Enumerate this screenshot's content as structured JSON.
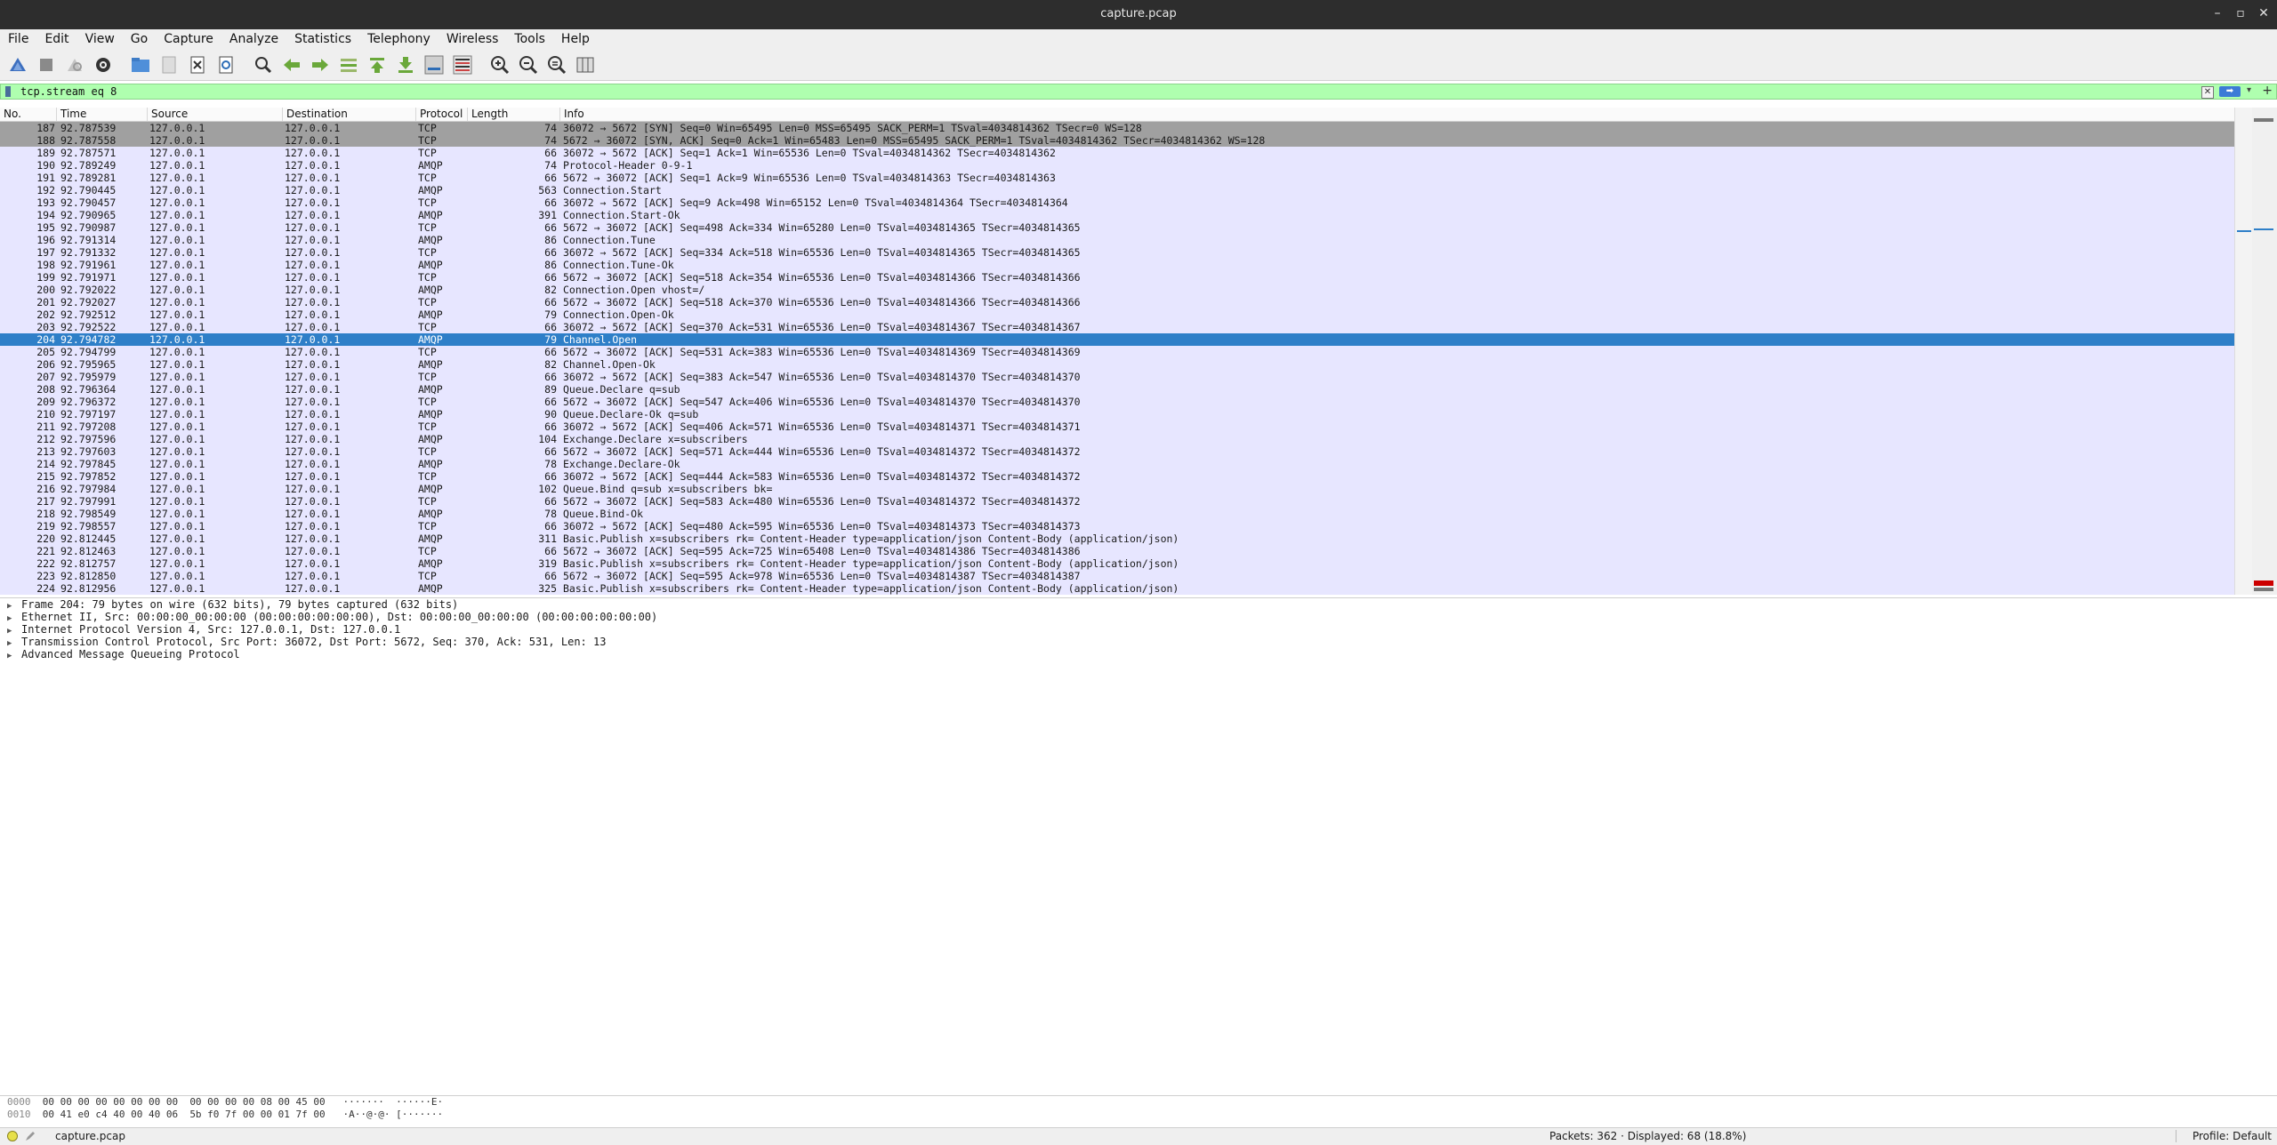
{
  "window": {
    "title": "capture.pcap"
  },
  "menu": [
    "File",
    "Edit",
    "View",
    "Go",
    "Capture",
    "Analyze",
    "Statistics",
    "Telephony",
    "Wireless",
    "Tools",
    "Help"
  ],
  "toolbar_icons": [
    "shark-start-icon",
    "stop-icon",
    "restart-icon",
    "options-gear-icon",
    "open-folder-icon",
    "file-icon",
    "close-file-icon",
    "reload-icon",
    "find-icon",
    "go-back-icon",
    "go-forward-icon",
    "go-to-packet-icon",
    "first-packet-icon",
    "last-packet-icon",
    "autoscroll-icon",
    "colorize-icon",
    "zoom-in-icon",
    "zoom-out-icon",
    "zoom-normal-icon",
    "resize-columns-icon"
  ],
  "filter": {
    "value": "tcp.stream eq 8"
  },
  "columns": [
    "No.",
    "Time",
    "Source",
    "Destination",
    "Protocol",
    "Length",
    "Info"
  ],
  "packets": [
    {
      "no": "187",
      "time": "92.787539",
      "src": "127.0.0.1",
      "dst": "127.0.0.1",
      "proto": "TCP",
      "len": "74",
      "info": "36072 → 5672 [SYN] Seq=0 Win=65495 Len=0 MSS=65495 SACK_PERM=1 TSval=4034814362 TSecr=0 WS=128",
      "style": "s"
    },
    {
      "no": "188",
      "time": "92.787558",
      "src": "127.0.0.1",
      "dst": "127.0.0.1",
      "proto": "TCP",
      "len": "74",
      "info": "5672 → 36072 [SYN, ACK] Seq=0 Ack=1 Win=65483 Len=0 MSS=65495 SACK_PERM=1 TSval=4034814362 TSecr=4034814362 WS=128",
      "style": "s"
    },
    {
      "no": "189",
      "time": "92.787571",
      "src": "127.0.0.1",
      "dst": "127.0.0.1",
      "proto": "TCP",
      "len": "66",
      "info": "36072 → 5672 [ACK] Seq=1 Ack=1 Win=65536 Len=0 TSval=4034814362 TSecr=4034814362",
      "style": ""
    },
    {
      "no": "190",
      "time": "92.789249",
      "src": "127.0.0.1",
      "dst": "127.0.0.1",
      "proto": "AMQP",
      "len": "74",
      "info": "Protocol-Header 0-9-1",
      "style": ""
    },
    {
      "no": "191",
      "time": "92.789281",
      "src": "127.0.0.1",
      "dst": "127.0.0.1",
      "proto": "TCP",
      "len": "66",
      "info": "5672 → 36072 [ACK] Seq=1 Ack=9 Win=65536 Len=0 TSval=4034814363 TSecr=4034814363",
      "style": ""
    },
    {
      "no": "192",
      "time": "92.790445",
      "src": "127.0.0.1",
      "dst": "127.0.0.1",
      "proto": "AMQP",
      "len": "563",
      "info": "Connection.Start",
      "style": ""
    },
    {
      "no": "193",
      "time": "92.790457",
      "src": "127.0.0.1",
      "dst": "127.0.0.1",
      "proto": "TCP",
      "len": "66",
      "info": "36072 → 5672 [ACK] Seq=9 Ack=498 Win=65152 Len=0 TSval=4034814364 TSecr=4034814364",
      "style": ""
    },
    {
      "no": "194",
      "time": "92.790965",
      "src": "127.0.0.1",
      "dst": "127.0.0.1",
      "proto": "AMQP",
      "len": "391",
      "info": "Connection.Start-Ok",
      "style": ""
    },
    {
      "no": "195",
      "time": "92.790987",
      "src": "127.0.0.1",
      "dst": "127.0.0.1",
      "proto": "TCP",
      "len": "66",
      "info": "5672 → 36072 [ACK] Seq=498 Ack=334 Win=65280 Len=0 TSval=4034814365 TSecr=4034814365",
      "style": ""
    },
    {
      "no": "196",
      "time": "92.791314",
      "src": "127.0.0.1",
      "dst": "127.0.0.1",
      "proto": "AMQP",
      "len": "86",
      "info": "Connection.Tune",
      "style": ""
    },
    {
      "no": "197",
      "time": "92.791332",
      "src": "127.0.0.1",
      "dst": "127.0.0.1",
      "proto": "TCP",
      "len": "66",
      "info": "36072 → 5672 [ACK] Seq=334 Ack=518 Win=65536 Len=0 TSval=4034814365 TSecr=4034814365",
      "style": ""
    },
    {
      "no": "198",
      "time": "92.791961",
      "src": "127.0.0.1",
      "dst": "127.0.0.1",
      "proto": "AMQP",
      "len": "86",
      "info": "Connection.Tune-Ok",
      "style": ""
    },
    {
      "no": "199",
      "time": "92.791971",
      "src": "127.0.0.1",
      "dst": "127.0.0.1",
      "proto": "TCP",
      "len": "66",
      "info": "5672 → 36072 [ACK] Seq=518 Ack=354 Win=65536 Len=0 TSval=4034814366 TSecr=4034814366",
      "style": ""
    },
    {
      "no": "200",
      "time": "92.792022",
      "src": "127.0.0.1",
      "dst": "127.0.0.1",
      "proto": "AMQP",
      "len": "82",
      "info": "Connection.Open vhost=/",
      "style": ""
    },
    {
      "no": "201",
      "time": "92.792027",
      "src": "127.0.0.1",
      "dst": "127.0.0.1",
      "proto": "TCP",
      "len": "66",
      "info": "5672 → 36072 [ACK] Seq=518 Ack=370 Win=65536 Len=0 TSval=4034814366 TSecr=4034814366",
      "style": ""
    },
    {
      "no": "202",
      "time": "92.792512",
      "src": "127.0.0.1",
      "dst": "127.0.0.1",
      "proto": "AMQP",
      "len": "79",
      "info": "Connection.Open-Ok",
      "style": ""
    },
    {
      "no": "203",
      "time": "92.792522",
      "src": "127.0.0.1",
      "dst": "127.0.0.1",
      "proto": "TCP",
      "len": "66",
      "info": "36072 → 5672 [ACK] Seq=370 Ack=531 Win=65536 Len=0 TSval=4034814367 TSecr=4034814367",
      "style": ""
    },
    {
      "no": "204",
      "time": "92.794782",
      "src": "127.0.0.1",
      "dst": "127.0.0.1",
      "proto": "AMQP",
      "len": "79",
      "info": "Channel.Open",
      "style": "sel"
    },
    {
      "no": "205",
      "time": "92.794799",
      "src": "127.0.0.1",
      "dst": "127.0.0.1",
      "proto": "TCP",
      "len": "66",
      "info": "5672 → 36072 [ACK] Seq=531 Ack=383 Win=65536 Len=0 TSval=4034814369 TSecr=4034814369",
      "style": ""
    },
    {
      "no": "206",
      "time": "92.795965",
      "src": "127.0.0.1",
      "dst": "127.0.0.1",
      "proto": "AMQP",
      "len": "82",
      "info": "Channel.Open-Ok",
      "style": ""
    },
    {
      "no": "207",
      "time": "92.795979",
      "src": "127.0.0.1",
      "dst": "127.0.0.1",
      "proto": "TCP",
      "len": "66",
      "info": "36072 → 5672 [ACK] Seq=383 Ack=547 Win=65536 Len=0 TSval=4034814370 TSecr=4034814370",
      "style": ""
    },
    {
      "no": "208",
      "time": "92.796364",
      "src": "127.0.0.1",
      "dst": "127.0.0.1",
      "proto": "AMQP",
      "len": "89",
      "info": "Queue.Declare q=sub",
      "style": ""
    },
    {
      "no": "209",
      "time": "92.796372",
      "src": "127.0.0.1",
      "dst": "127.0.0.1",
      "proto": "TCP",
      "len": "66",
      "info": "5672 → 36072 [ACK] Seq=547 Ack=406 Win=65536 Len=0 TSval=4034814370 TSecr=4034814370",
      "style": ""
    },
    {
      "no": "210",
      "time": "92.797197",
      "src": "127.0.0.1",
      "dst": "127.0.0.1",
      "proto": "AMQP",
      "len": "90",
      "info": "Queue.Declare-Ok q=sub",
      "style": ""
    },
    {
      "no": "211",
      "time": "92.797208",
      "src": "127.0.0.1",
      "dst": "127.0.0.1",
      "proto": "TCP",
      "len": "66",
      "info": "36072 → 5672 [ACK] Seq=406 Ack=571 Win=65536 Len=0 TSval=4034814371 TSecr=4034814371",
      "style": ""
    },
    {
      "no": "212",
      "time": "92.797596",
      "src": "127.0.0.1",
      "dst": "127.0.0.1",
      "proto": "AMQP",
      "len": "104",
      "info": "Exchange.Declare x=subscribers",
      "style": ""
    },
    {
      "no": "213",
      "time": "92.797603",
      "src": "127.0.0.1",
      "dst": "127.0.0.1",
      "proto": "TCP",
      "len": "66",
      "info": "5672 → 36072 [ACK] Seq=571 Ack=444 Win=65536 Len=0 TSval=4034814372 TSecr=4034814372",
      "style": ""
    },
    {
      "no": "214",
      "time": "92.797845",
      "src": "127.0.0.1",
      "dst": "127.0.0.1",
      "proto": "AMQP",
      "len": "78",
      "info": "Exchange.Declare-Ok",
      "style": ""
    },
    {
      "no": "215",
      "time": "92.797852",
      "src": "127.0.0.1",
      "dst": "127.0.0.1",
      "proto": "TCP",
      "len": "66",
      "info": "36072 → 5672 [ACK] Seq=444 Ack=583 Win=65536 Len=0 TSval=4034814372 TSecr=4034814372",
      "style": ""
    },
    {
      "no": "216",
      "time": "92.797984",
      "src": "127.0.0.1",
      "dst": "127.0.0.1",
      "proto": "AMQP",
      "len": "102",
      "info": "Queue.Bind q=sub x=subscribers bk=",
      "style": ""
    },
    {
      "no": "217",
      "time": "92.797991",
      "src": "127.0.0.1",
      "dst": "127.0.0.1",
      "proto": "TCP",
      "len": "66",
      "info": "5672 → 36072 [ACK] Seq=583 Ack=480 Win=65536 Len=0 TSval=4034814372 TSecr=4034814372",
      "style": ""
    },
    {
      "no": "218",
      "time": "92.798549",
      "src": "127.0.0.1",
      "dst": "127.0.0.1",
      "proto": "AMQP",
      "len": "78",
      "info": "Queue.Bind-Ok",
      "style": ""
    },
    {
      "no": "219",
      "time": "92.798557",
      "src": "127.0.0.1",
      "dst": "127.0.0.1",
      "proto": "TCP",
      "len": "66",
      "info": "36072 → 5672 [ACK] Seq=480 Ack=595 Win=65536 Len=0 TSval=4034814373 TSecr=4034814373",
      "style": ""
    },
    {
      "no": "220",
      "time": "92.812445",
      "src": "127.0.0.1",
      "dst": "127.0.0.1",
      "proto": "AMQP",
      "len": "311",
      "info": "Basic.Publish x=subscribers rk= Content-Header type=application/json Content-Body  (application/json)",
      "style": ""
    },
    {
      "no": "221",
      "time": "92.812463",
      "src": "127.0.0.1",
      "dst": "127.0.0.1",
      "proto": "TCP",
      "len": "66",
      "info": "5672 → 36072 [ACK] Seq=595 Ack=725 Win=65408 Len=0 TSval=4034814386 TSecr=4034814386",
      "style": ""
    },
    {
      "no": "222",
      "time": "92.812757",
      "src": "127.0.0.1",
      "dst": "127.0.0.1",
      "proto": "AMQP",
      "len": "319",
      "info": "Basic.Publish x=subscribers rk= Content-Header type=application/json Content-Body  (application/json)",
      "style": ""
    },
    {
      "no": "223",
      "time": "92.812850",
      "src": "127.0.0.1",
      "dst": "127.0.0.1",
      "proto": "TCP",
      "len": "66",
      "info": "5672 → 36072 [ACK] Seq=595 Ack=978 Win=65536 Len=0 TSval=4034814387 TSecr=4034814387",
      "style": ""
    },
    {
      "no": "224",
      "time": "92.812956",
      "src": "127.0.0.1",
      "dst": "127.0.0.1",
      "proto": "AMQP",
      "len": "325",
      "info": "Basic.Publish x=subscribers rk= Content-Header type=application/json Content-Body  (application/json)",
      "style": ""
    }
  ],
  "details": [
    "Frame 204: 79 bytes on wire (632 bits), 79 bytes captured (632 bits)",
    "Ethernet II, Src: 00:00:00_00:00:00 (00:00:00:00:00:00), Dst: 00:00:00_00:00:00 (00:00:00:00:00:00)",
    "Internet Protocol Version 4, Src: 127.0.0.1, Dst: 127.0.0.1",
    "Transmission Control Protocol, Src Port: 36072, Dst Port: 5672, Seq: 370, Ack: 531, Len: 13",
    "Advanced Message Queueing Protocol"
  ],
  "bytes": [
    {
      "offset": "0000",
      "hex": "00 00 00 00 00 00 00 00  00 00 00 00 08 00 45 00",
      "ascii": "·······  ······E·"
    },
    {
      "offset": "0010",
      "hex": "00 41 e0 c4 40 00 40 06  5b f0 7f 00 00 01 7f 00",
      "ascii": "·A··@·@· [·······"
    }
  ],
  "status": {
    "file": "capture.pcap",
    "packets": "Packets: 362 · Displayed: 68 (18.8%)",
    "profile": "Profile: Default"
  },
  "colors": {
    "selected": "#2e7fc8",
    "row": "#e7e6ff",
    "syn_row": "#a0a0a0",
    "filter_ok": "#afffaf"
  }
}
